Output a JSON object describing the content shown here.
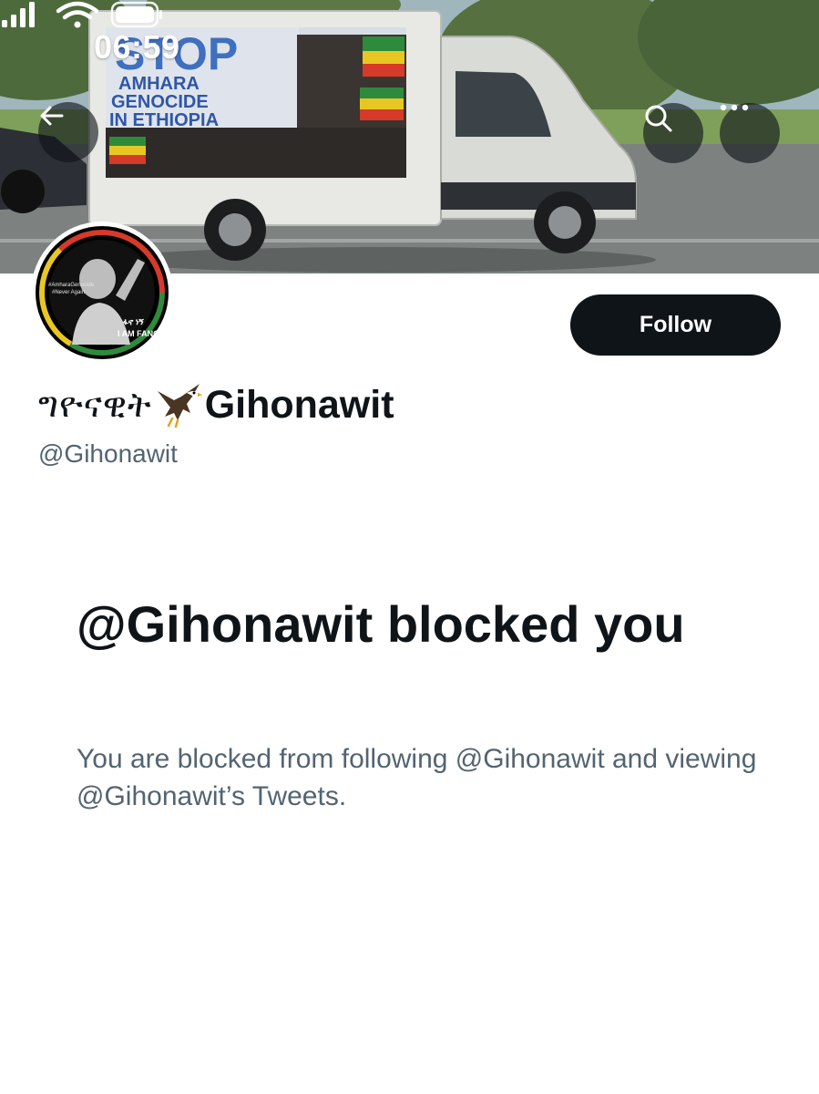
{
  "status_bar": {
    "time": "06:59",
    "icons": [
      "cellular-signal-icon",
      "wifi-icon",
      "battery-icon"
    ]
  },
  "banner": {
    "billboard_line1": "STOP",
    "billboard_line2": "AMHARA",
    "billboard_line3": "GENOCIDE",
    "billboard_line4": "IN ETHIOPIA"
  },
  "header_buttons": {
    "back_icon": "arrow-left-icon",
    "search_icon": "search-icon",
    "more_icon": "more-horizontal-icon"
  },
  "profile": {
    "avatar_text_top_1": "#AmharaGenocide",
    "avatar_text_top_2": "#Never Again",
    "avatar_text_amharic": "ፋኖ ነኝ",
    "avatar_text_bottom": "I AM FANO",
    "display_name_amharic": "ግዮናዊት",
    "display_name_emoji": "eagle-icon",
    "display_name_latin": "Gihonawit",
    "handle": "@Gihonawit",
    "follow_label": "Follow"
  },
  "blocked": {
    "title": "@Gihonawit blocked you",
    "description": "You are blocked from following @Gihonawit and viewing @Gihonawit’s Tweets."
  },
  "colors": {
    "text_primary": "#0f1419",
    "text_secondary": "#536471",
    "button_background": "#0f1419",
    "billboard_blue": "#3f6fbf"
  }
}
